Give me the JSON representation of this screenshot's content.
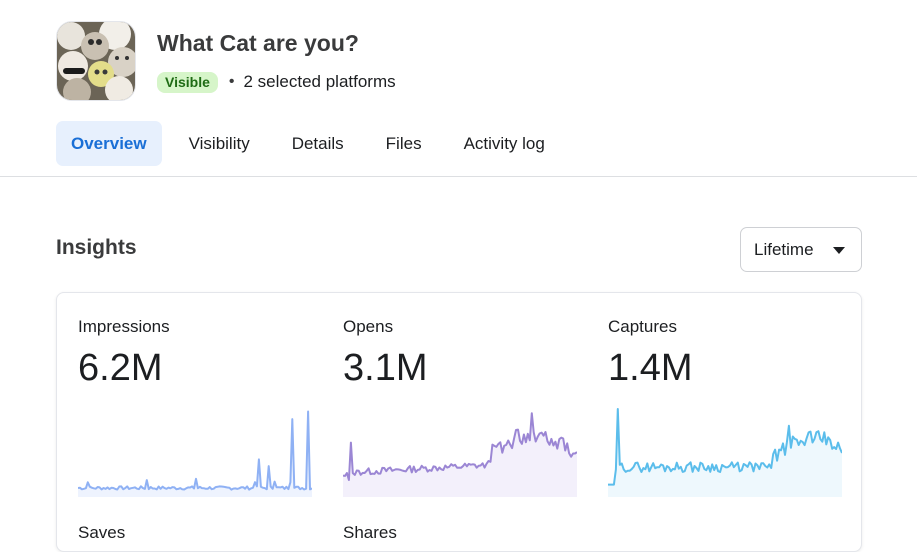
{
  "app": {
    "title": "What Cat are you?",
    "status_badge": "Visible",
    "separator": "•",
    "platforms": "2 selected platforms"
  },
  "tabs": [
    {
      "label": "Overview",
      "active": true
    },
    {
      "label": "Visibility",
      "active": false
    },
    {
      "label": "Details",
      "active": false
    },
    {
      "label": "Files",
      "active": false
    },
    {
      "label": "Activity log",
      "active": false
    }
  ],
  "insights": {
    "title": "Insights",
    "range": "Lifetime",
    "metrics": [
      {
        "label": "Impressions",
        "value": "6.2M",
        "color": "#8fb1f4",
        "fill": "#eef3fe"
      },
      {
        "label": "Opens",
        "value": "3.1M",
        "color": "#9b86d4",
        "fill": "#f3f0fb"
      },
      {
        "label": "Captures",
        "value": "1.4M",
        "color": "#5bbdeb",
        "fill": "#eef8fd"
      }
    ],
    "more_metrics": [
      {
        "label": "Saves"
      },
      {
        "label": "Shares"
      }
    ]
  },
  "colors": {
    "accent": "#1a6fd6",
    "tab_active_bg": "#e7f0fd",
    "badge_bg": "#d6f5c9",
    "badge_text": "#1e6b14"
  },
  "icons": {
    "thumbnail": "cat-collage-thumbnail",
    "range_caret": "caret-down-icon"
  }
}
